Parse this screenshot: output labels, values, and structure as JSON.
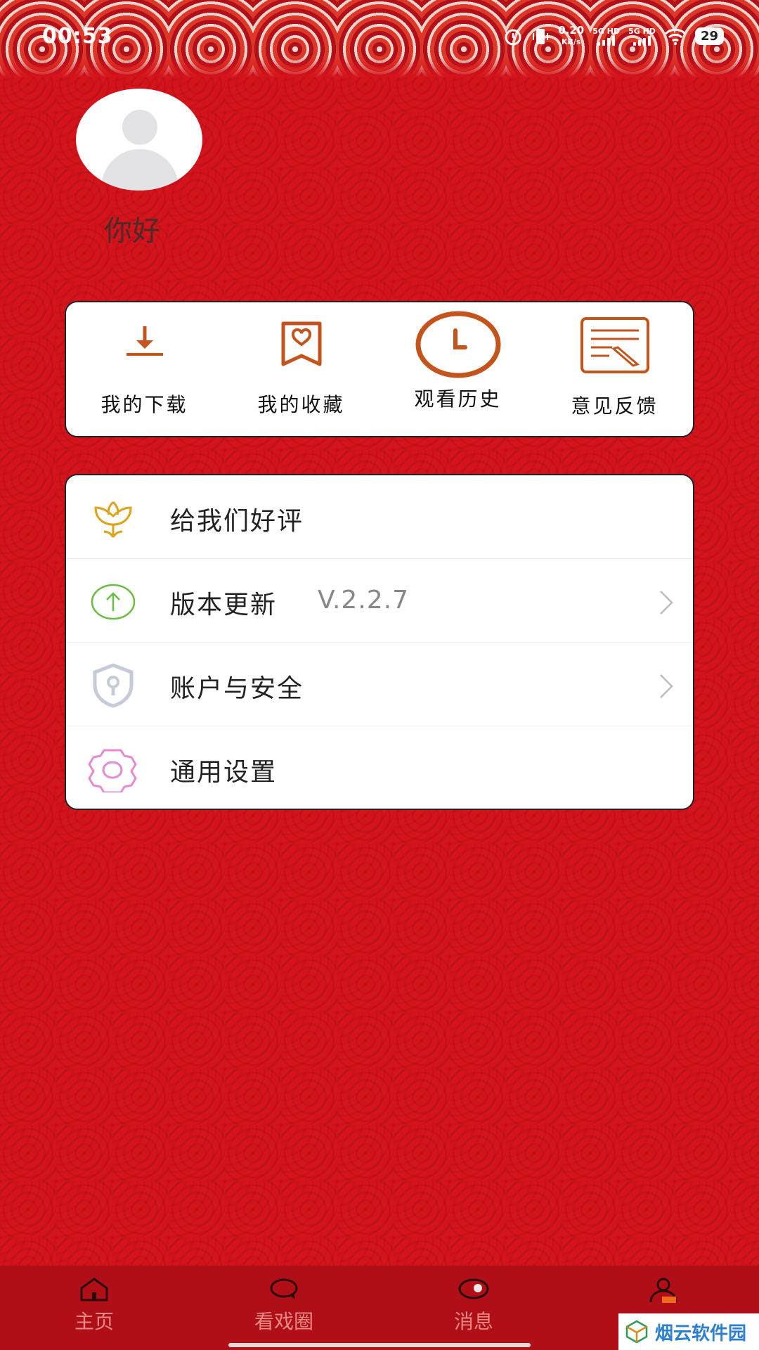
{
  "status_bar": {
    "time": "00:53",
    "net_speed_value": "0.20",
    "net_speed_unit": "KB/s",
    "sim1": "5G HD",
    "sim2": "5G HD",
    "battery": "29"
  },
  "profile": {
    "greeting": "你好"
  },
  "quick_actions": [
    {
      "label": "我的下载",
      "icon": "download-icon"
    },
    {
      "label": "我的收藏",
      "icon": "bookmark-heart-icon"
    },
    {
      "label": "观看历史",
      "icon": "clock-icon"
    },
    {
      "label": "意见反馈",
      "icon": "edit-note-icon"
    }
  ],
  "menu": [
    {
      "label": "给我们好评",
      "icon": "flower-icon"
    },
    {
      "label": "版本更新",
      "value": "V.2.2.7",
      "icon": "upload-circle-icon"
    },
    {
      "label": "账户与安全",
      "icon": "shield-lock-icon"
    },
    {
      "label": "通用设置",
      "icon": "gear-icon"
    }
  ],
  "tabs": [
    {
      "label": "主页",
      "icon": "home-icon"
    },
    {
      "label": "看戏圈",
      "icon": "chat-bubble-icon"
    },
    {
      "label": "消息",
      "icon": "message-icon"
    },
    {
      "label": "",
      "icon": "profile-icon"
    }
  ],
  "watermark": "烟云软件园",
  "colors": {
    "background_red": "#d5131b",
    "accent_brown": "#c4531c",
    "tabbar_red": "#b10f18"
  }
}
